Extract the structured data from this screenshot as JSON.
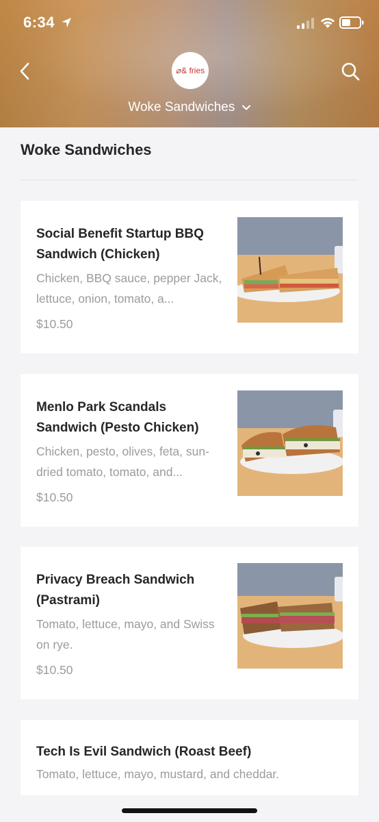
{
  "status": {
    "time": "6:34"
  },
  "header": {
    "logo_mark": "⌀",
    "logo_text": "& fries",
    "restaurant_name": "Woke Sandwiches"
  },
  "section": {
    "title": "Woke Sandwiches"
  },
  "items": [
    {
      "name": "Social Benefit Startup BBQ Sandwich (Chicken)",
      "description": "Chicken, BBQ sauce, pepper Jack, lettuce, onion, tomato, a...",
      "price": "$10.50",
      "image_icon": "bbq-chicken-sandwich-photo"
    },
    {
      "name": "Menlo Park Scandals Sandwich (Pesto Chicken)",
      "description": "Chicken, pesto, olives, feta, sun-dried tomato, tomato, and...",
      "price": "$10.50",
      "image_icon": "pesto-chicken-sandwich-photo"
    },
    {
      "name": "Privacy Breach Sandwich (Pastrami)",
      "description": "Tomato, lettuce, mayo, and Swiss on rye.",
      "price": "$10.50",
      "image_icon": "pastrami-sandwich-photo"
    },
    {
      "name": "Tech Is Evil Sandwich (Roast Beef)",
      "description": "Tomato, lettuce, mayo, mustard, and cheddar."
    }
  ],
  "colors": {
    "header_tint": "#c98f4a",
    "text_primary": "#262628",
    "text_secondary": "#9b9ba1",
    "background": "#f4f4f6",
    "logo_red": "#c5322f"
  }
}
